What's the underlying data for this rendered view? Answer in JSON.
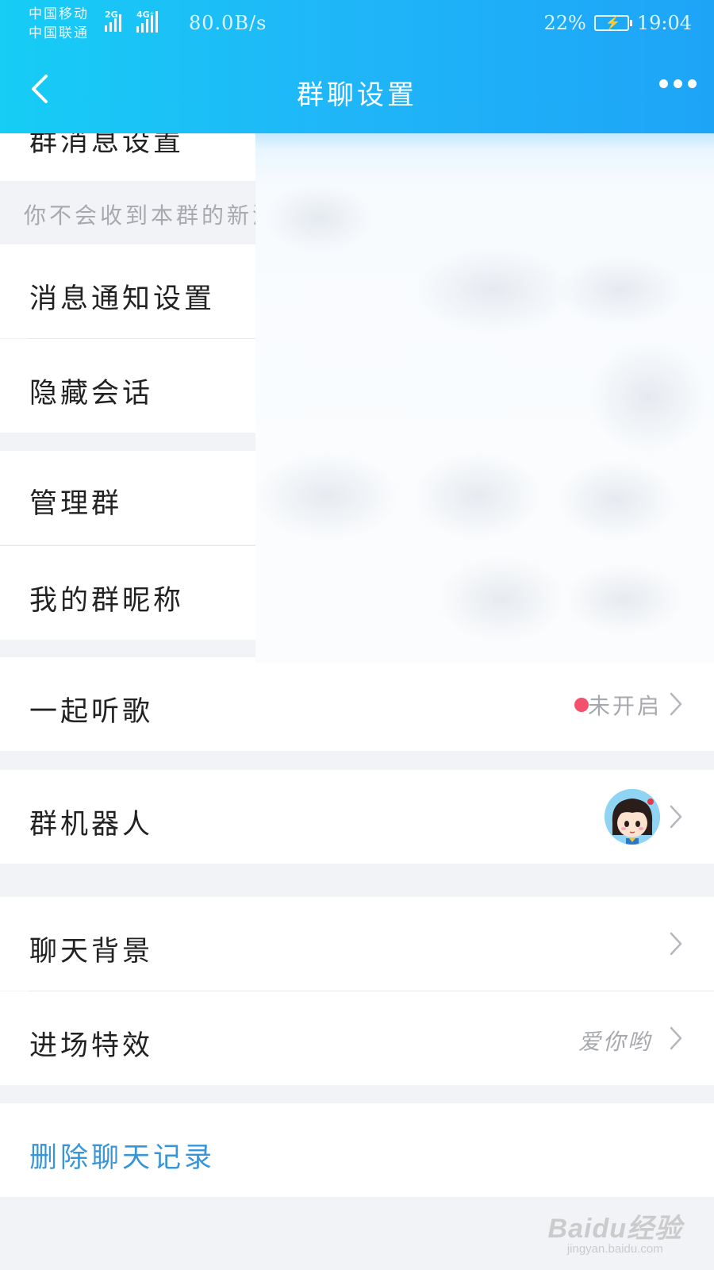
{
  "status_bar": {
    "carrier_1": "中国移动",
    "carrier_2": "中国联通",
    "net_1": "2G",
    "net_2": "4G⁺",
    "speed": "80.0B/s",
    "battery": "22%",
    "time": "19:04"
  },
  "nav": {
    "title": "群聊设置",
    "back_icon": "chevron-left-icon",
    "more_icon": "more-dots-icon"
  },
  "sections": {
    "group_msg_settings": "群消息设置",
    "group_msg_hint": "你不会收到本群的新消",
    "msg_notify_settings": "消息通知设置",
    "hide_chat": "隐藏会话",
    "manage_group": "管理群",
    "my_nickname": "我的群昵称",
    "listen_together": {
      "label": "一起听歌",
      "status": "未开启"
    },
    "group_robot": {
      "label": "群机器人"
    },
    "chat_background": {
      "label": "聊天背景"
    },
    "entry_effect": {
      "label": "进场特效",
      "value": "爱你哟"
    },
    "delete_history": "删除聊天记录"
  },
  "colors": {
    "header_start": "#16cdf5",
    "header_end": "#1ea4f7",
    "danger_text": "#3a95d6",
    "status_dot": "#f5506d"
  },
  "watermark": {
    "logo": "Baidu经验",
    "url": "jingyan.baidu.com"
  }
}
